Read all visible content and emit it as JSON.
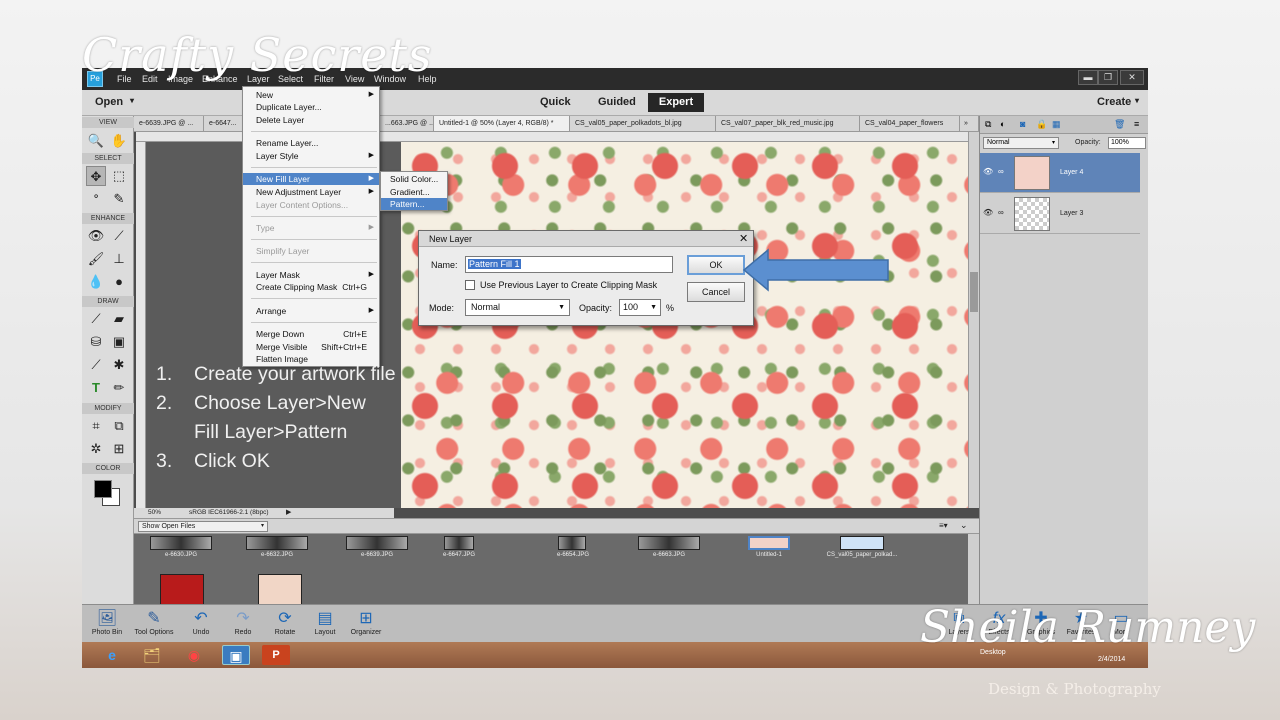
{
  "slide": {
    "title": "Crafty Secrets",
    "signature": "Sheila Rumney",
    "subtitle": "Design & Photography"
  },
  "steps": [
    {
      "num": "1.",
      "text": "Create your artwork file"
    },
    {
      "num": "2.",
      "text": "Choose Layer>New Fill Layer>Pattern"
    },
    {
      "num": "3.",
      "text": "Click OK"
    }
  ],
  "menubar": {
    "items": [
      "File",
      "Edit",
      "Image",
      "Enhance",
      "Layer",
      "Select",
      "Filter",
      "View",
      "Window",
      "Help"
    ],
    "minimize": "▬",
    "restore": "❐",
    "close": "✕"
  },
  "modebar": {
    "open": "Open",
    "quick": "Quick",
    "guided": "Guided",
    "expert": "Expert",
    "create": "Create"
  },
  "toolbox": {
    "view": "VIEW",
    "select": "SELECT",
    "enhance": "ENHANCE",
    "draw": "DRAW",
    "modify": "MODIFY",
    "color": "COLOR"
  },
  "tabs": [
    "e-6639.JPG @ ...",
    "e-6647...",
    "...663.JPG @ ...",
    "Untitled-1 @ 50% (Layer 4, RGB/8) *",
    "CS_val05_paper_polkadots_bl.jpg",
    "CS_val07_paper_blk_red_music.jpg",
    "CS_val04_paper_flowers"
  ],
  "tabs_more": "»",
  "status": {
    "zoom": "50%",
    "profile": "sRGB IEC61966-2.1 (8bpc)"
  },
  "bin": {
    "show": "Show Open Files",
    "thumbs": [
      "e-6630.JPG",
      "e-6632.JPG",
      "e-6639.JPG",
      "e-6647.JPG",
      "e-6654.JPG",
      "e-6663.JPG",
      "Untitled-1",
      "CS_val05_paper_polkad..."
    ]
  },
  "layers": {
    "blend": "Normal",
    "opacity_label": "Opacity:",
    "opacity": "100%",
    "items": [
      {
        "name": "Layer 4",
        "selected": true
      },
      {
        "name": "Layer 3",
        "selected": false
      }
    ]
  },
  "layer_menu": {
    "new": "New",
    "duplicate": "Duplicate Layer...",
    "delete": "Delete Layer",
    "rename": "Rename Layer...",
    "style": "Layer Style",
    "new_fill": "New Fill Layer",
    "new_adjust": "New Adjustment Layer",
    "content_opts": "Layer Content Options...",
    "type": "Type",
    "simplify": "Simplify Layer",
    "mask": "Layer Mask",
    "clipping": "Create Clipping Mask",
    "clipping_sc": "Ctrl+G",
    "arrange": "Arrange",
    "merge_down": "Merge Down",
    "merge_down_sc": "Ctrl+E",
    "merge_visible": "Merge Visible",
    "merge_visible_sc": "Shift+Ctrl+E",
    "flatten": "Flatten Image"
  },
  "fill_submenu": {
    "solid": "Solid Color...",
    "gradient": "Gradient...",
    "pattern": "Pattern..."
  },
  "dialog": {
    "title": "New Layer",
    "name_label": "Name:",
    "name_value": "Pattern Fill 1",
    "clip_label": "Use Previous Layer to Create Clipping Mask",
    "mode_label": "Mode:",
    "mode_value": "Normal",
    "opacity_label": "Opacity:",
    "opacity_value": "100",
    "percent": "%",
    "ok": "OK",
    "cancel": "Cancel"
  },
  "bottombar": {
    "photo_bin": "Photo Bin",
    "tool_options": "Tool Options",
    "undo": "Undo",
    "redo": "Redo",
    "rotate": "Rotate",
    "layout": "Layout",
    "organizer": "Organizer",
    "layers": "Layers",
    "effects": "Effects",
    "graphics": "Graphics",
    "favorites": "Favorites",
    "more": "More"
  },
  "taskbar": {
    "desktop": "Desktop",
    "date": "2/4/2014"
  },
  "colors": {
    "accent": "#4f84c8",
    "layer_selected": "#5f84b8",
    "arrow": "#5b8fd0"
  }
}
